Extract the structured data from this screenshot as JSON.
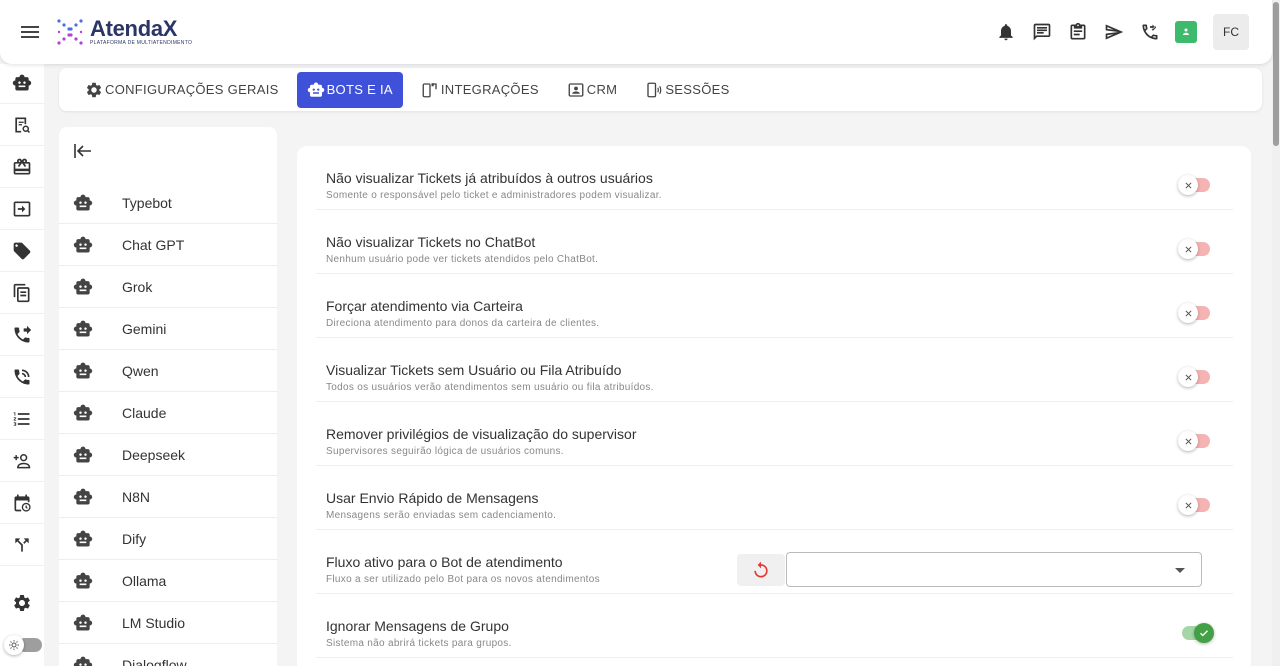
{
  "app": {
    "name": "AtendaX",
    "tagline": "PLATAFORMA DE MULTIATENDIMENTO"
  },
  "header": {
    "avatar_initials": "FC",
    "icons": [
      "bell-icon",
      "chat-icon",
      "clipboard-icon",
      "send-icon",
      "phone-call-icon",
      "user-status-icon"
    ],
    "status_color": "#3dba6b"
  },
  "rail": {
    "icons": [
      "robot-icon",
      "receipt-search-icon",
      "gift-icon",
      "message-forward-icon",
      "tag-icon",
      "clipboard-list-icon",
      "phone-forward-icon",
      "phone-transfer-icon",
      "list-numbered-icon",
      "person-add-icon",
      "calendar-clock-icon",
      "fork-icon",
      "settings-icon"
    ]
  },
  "tabs": [
    {
      "label": "CONFIGURAÇÕES GERAIS",
      "icon": "gear-icon",
      "active": false
    },
    {
      "label": "BOTS E IA",
      "icon": "robot-icon",
      "active": true
    },
    {
      "label": "INTEGRAÇÕES",
      "icon": "phone-link-icon",
      "active": false
    },
    {
      "label": "CRM",
      "icon": "contact-card-icon",
      "active": false
    },
    {
      "label": "SESSÕES",
      "icon": "phone-wifi-icon",
      "active": false
    }
  ],
  "bots": [
    "Typebot",
    "Chat GPT",
    "Grok",
    "Gemini",
    "Qwen",
    "Claude",
    "Deepseek",
    "N8N",
    "Dify",
    "Ollama",
    "LM Studio",
    "Dialogflow"
  ],
  "settings": [
    {
      "title": "Não visualizar Tickets já atribuídos à outros usuários",
      "desc": "Somente o responsável pelo ticket e administradores podem visualizar.",
      "enabled": false
    },
    {
      "title": "Não visualizar Tickets no ChatBot",
      "desc": "Nenhum usuário pode ver tickets atendidos pelo ChatBot.",
      "enabled": false
    },
    {
      "title": "Forçar atendimento via Carteira",
      "desc": "Direciona atendimento para donos da carteira de clientes.",
      "enabled": false
    },
    {
      "title": "Visualizar Tickets sem Usuário ou Fila Atribuído",
      "desc": "Todos os usuários verão atendimentos sem usuário ou fila atribuídos.",
      "enabled": false
    },
    {
      "title": "Remover privilégios de visualização do supervisor",
      "desc": "Supervisores seguirão lógica de usuários comuns.",
      "enabled": false
    },
    {
      "title": "Usar Envio Rápido de Mensagens",
      "desc": "Mensagens serão enviadas sem cadenciamento.",
      "enabled": false
    },
    {
      "title": "Fluxo ativo para o Bot de atendimento",
      "desc": "Fluxo a ser utilizado pelo Bot para os novos atendimentos",
      "select_value": ""
    },
    {
      "title": "Ignorar Mensagens de Grupo",
      "desc": "Sistema não abrirá tickets para grupos.",
      "enabled": true
    }
  ],
  "colors": {
    "accent": "#3f51d8",
    "toggle_off": "#f5b3b3",
    "toggle_on": "#43a047",
    "reset_icon": "#e53935"
  }
}
